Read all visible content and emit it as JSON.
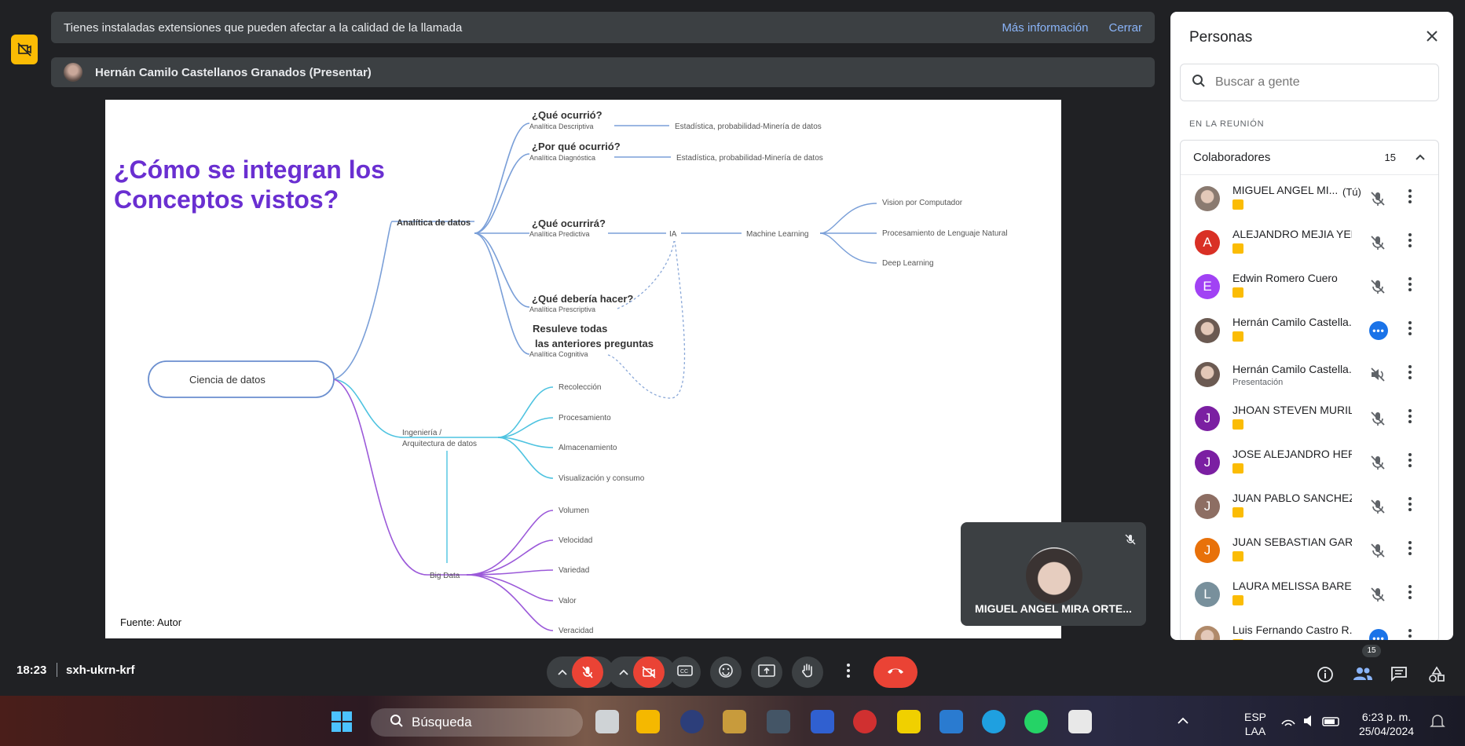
{
  "banner": {
    "message": "Tienes instaladas extensiones que pueden afectar a la calidad de la llamada",
    "more_info": "Más información",
    "close": "Cerrar"
  },
  "presenter": {
    "name": "Hernán Camilo Castellanos Granados (Presentar)"
  },
  "slide": {
    "title_line1": "¿Cómo se integran los",
    "title_line2": "Conceptos vistos?",
    "source": "Fuente: Autor",
    "root": "Ciencia de datos",
    "analytics": "Analítica de datos",
    "q1": "¿Qué ocurrió?",
    "q1_sub": "Analítica Descriptiva",
    "q1_right": "Estadística, probabilidad-Minería de datos",
    "q2": "¿Por qué ocurrió?",
    "q2_sub": "Analítica Diagnóstica",
    "q2_right": "Estadística, probabilidad-Minería de datos",
    "q3": "¿Qué ocurrirá?",
    "q3_sub": "Analítica Predictiva",
    "ia": "IA",
    "ml": "Machine Learning",
    "ml1": "Vision por Computador",
    "ml2": "Procesamiento de Lenguaje Natural",
    "ml3": "Deep Learning",
    "q4": "¿Qué debería hacer?",
    "q4_sub": "Analítica Prescriptiva",
    "q5a": "Resuleve todas",
    "q5b": "las anteriores preguntas",
    "q5_sub": "Analítica Cognitiva",
    "eng1": "Ingeniería /",
    "eng2": "Arquitectura de datos",
    "eng_items": [
      "Recolección",
      "Procesamiento",
      "Almacenamiento",
      "Visualización y consumo"
    ],
    "bigdata": "Big Data",
    "bd_items": [
      "Volumen",
      "Velocidad",
      "Variedad",
      "Valor",
      "Veracidad"
    ]
  },
  "selfview": {
    "name": "MIGUEL ANGEL MIRA ORTE..."
  },
  "panel": {
    "title": "Personas",
    "search_placeholder": "Buscar a gente",
    "section": "EN LA REUNIÓN",
    "group_label": "Colaboradores",
    "group_count": "15",
    "people": [
      {
        "name": "MIGUEL ANGEL MI...",
        "tag": "(Tú)",
        "initial": "",
        "color": "#8a7a70",
        "photo": true,
        "sub": "",
        "state": "muted"
      },
      {
        "name": "ALEJANDRO MEJIA YEP...",
        "tag": "",
        "initial": "A",
        "color": "#d93025",
        "photo": false,
        "sub": "",
        "state": "muted"
      },
      {
        "name": "Edwin Romero Cuero",
        "tag": "",
        "initial": "E",
        "color": "#a142f4",
        "photo": false,
        "sub": "",
        "state": "muted"
      },
      {
        "name": "Hernán Camilo Castella...",
        "tag": "",
        "initial": "",
        "color": "#6b5a52",
        "photo": true,
        "sub": "",
        "state": "speaking"
      },
      {
        "name": "Hernán Camilo Castella...",
        "tag": "",
        "initial": "",
        "color": "#6b5a52",
        "photo": true,
        "sub": "Presentación",
        "state": "audio-off"
      },
      {
        "name": "JHOAN STEVEN MURILL...",
        "tag": "",
        "initial": "J",
        "color": "#7b1fa2",
        "photo": false,
        "sub": "",
        "state": "muted"
      },
      {
        "name": "JOSE ALEJANDRO HER...",
        "tag": "",
        "initial": "J",
        "color": "#7b1fa2",
        "photo": false,
        "sub": "",
        "state": "muted"
      },
      {
        "name": "JUAN PABLO SANCHEZ...",
        "tag": "",
        "initial": "J",
        "color": "#8d6e63",
        "photo": false,
        "sub": "",
        "state": "muted"
      },
      {
        "name": "JUAN SEBASTIAN GAR...",
        "tag": "",
        "initial": "J",
        "color": "#e8710a",
        "photo": false,
        "sub": "",
        "state": "muted"
      },
      {
        "name": "LAURA MELISSA BAREÑ...",
        "tag": "",
        "initial": "L",
        "color": "#78909c",
        "photo": false,
        "sub": "",
        "state": "muted"
      },
      {
        "name": "Luis Fernando Castro R...",
        "tag": "",
        "initial": "",
        "color": "#b08a6a",
        "photo": true,
        "sub": "",
        "state": "speaking"
      }
    ]
  },
  "meeting": {
    "time": "18:23",
    "code": "sxh-ukrn-krf",
    "people_count": "15"
  },
  "taskbar": {
    "search": "Búsqueda",
    "lang1": "ESP",
    "lang2": "LAA",
    "clock_time": "6:23 p. m.",
    "clock_date": "25/04/2024"
  }
}
